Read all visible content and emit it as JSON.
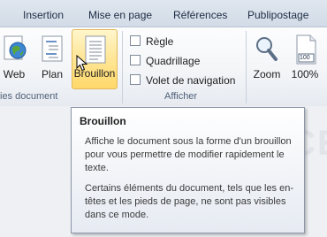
{
  "tabs": [
    {
      "label": "Insertion"
    },
    {
      "label": "Mise en page"
    },
    {
      "label": "Références"
    },
    {
      "label": "Publipostage"
    }
  ],
  "views_group": {
    "label": "ies document",
    "buttons": [
      {
        "label": "Web"
      },
      {
        "label": "Plan"
      },
      {
        "label": "Brouillon",
        "highlighted": true
      }
    ]
  },
  "show_group": {
    "label": "Afficher",
    "options": [
      {
        "label": "Règle",
        "checked": false
      },
      {
        "label": "Quadrillage",
        "checked": false
      },
      {
        "label": "Volet de navigation",
        "checked": false
      }
    ]
  },
  "zoom_group": {
    "buttons": [
      {
        "label": "Zoom"
      },
      {
        "label": "100%",
        "icon_text": "100"
      }
    ]
  },
  "tooltip": {
    "title": "Brouillon",
    "paragraph1": "Affiche le document sous la forme d'un brouillon pour vous permettre de modifier rapidement le texte.",
    "paragraph2": "Certains éléments du document, tels que les en-têtes et les pieds de page, ne sont pas visibles dans ce mode."
  },
  "colors": {
    "ribbon_bg": "#f3f5f8",
    "tab_bar_bg": "#d2dbe7",
    "highlight_fill": "#ffe79a",
    "highlight_border": "#e3b95a",
    "tooltip_border": "#8b96a7"
  }
}
